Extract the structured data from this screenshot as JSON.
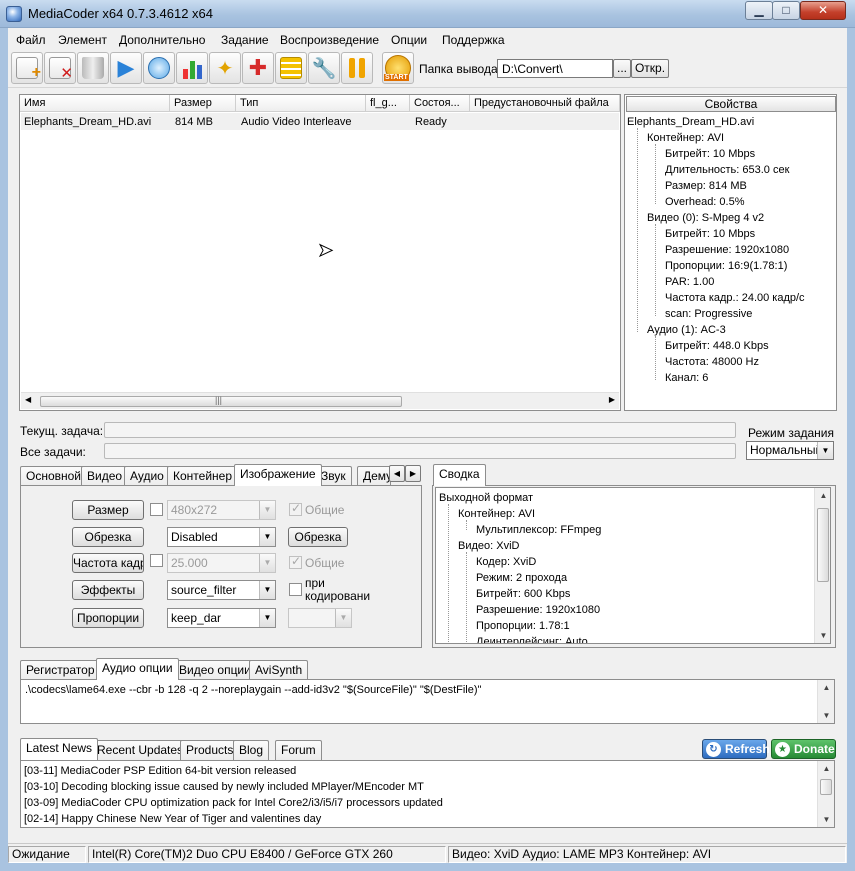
{
  "window": {
    "title": "MediaCoder x64 0.7.3.4612 x64"
  },
  "menu": [
    "Файл",
    "Элемент",
    "Дополнительно",
    "Задание",
    "Воспроизведение",
    "Опции",
    "Поддержка"
  ],
  "toolbar": {
    "buttons": [
      "add-file",
      "remove-file",
      "clear-list",
      "play",
      "preview",
      "stats",
      "wizard",
      "puzzle",
      "queue",
      "settings",
      "pause",
      "start"
    ],
    "start_label": "START",
    "output_label": "Папка вывода",
    "output_value": "D:\\Convert\\",
    "browse_label": "...",
    "open_label": "Откр."
  },
  "filelist": {
    "columns": [
      "Имя",
      "Размер",
      "Тип",
      "fl_g...",
      "Состоя...",
      "Предустановочный файла"
    ],
    "rows": [
      {
        "name": "Elephants_Dream_HD.avi",
        "size": "814 MB",
        "type": "Audio Video Interleave",
        "flg": "",
        "state": "Ready",
        "preset": ""
      }
    ]
  },
  "properties": {
    "header": "Свойства",
    "tree": [
      "Elephants_Dream_HD.avi",
      "Контейнер: AVI",
      "Битрейт: 10 Mbps",
      "Длительность: 653.0 сек",
      "Размер: 814 MB",
      "Overhead: 0.5%",
      "Видео (0): S-Mpeg 4 v2",
      "Битрейт: 10 Mbps",
      "Разрешение: 1920x1080",
      "Пропорции: 16:9(1.78:1)",
      "PAR: 1.00",
      "Частота кадр.: 24.00 кадр/с",
      "scan: Progressive",
      "Аудио (1): AC-3",
      "Битрейт: 448.0 Kbps",
      "Частота: 48000 Hz",
      "Канал: 6"
    ]
  },
  "progress": {
    "current_label": "Текущ. задача:",
    "all_label": "Все задачи:",
    "mode_label": "Режим задания",
    "mode_value": "Нормальный"
  },
  "settings_tabs": [
    "Основной",
    "Видео",
    "Аудио",
    "Контейнер",
    "Изображение",
    "Звук",
    "Дему"
  ],
  "image_panel": {
    "size_btn": "Размер",
    "size_value": "480x272",
    "general1": "Общие",
    "crop_btn": "Обрезка",
    "crop_value": "Disabled",
    "crop_btn2": "Обрезка",
    "fps_btn": "Частота кадр",
    "fps_value": "25.000",
    "general2": "Общие",
    "effects_btn": "Эффекты",
    "effects_value": "source_filter",
    "encode_label": "при кодировани",
    "aspect_btn": "Пропорции",
    "aspect_value": "keep_dar"
  },
  "summary": {
    "tab": "Сводка",
    "tree": [
      "Выходной формат",
      "Контейнер: AVI",
      "Мультиплексор: FFmpeg",
      "Видео: XviD",
      "Кодер: XviD",
      "Режим: 2 прохода",
      "Битрейт: 600 Kbps",
      "Разрешение: 1920x1080",
      "Пропорции: 1.78:1",
      "Деинтерлейсинг: Auto"
    ]
  },
  "cmd_tabs": [
    "Регистратор",
    "Аудио опции",
    "Видео опции",
    "AviSynth"
  ],
  "cmdline": ".\\codecs\\lame64.exe --cbr -b 128 -q 2 --noreplaygain --add-id3v2 \"$(SourceFile)\" \"$(DestFile)\"",
  "news_tabs": [
    "Latest News",
    "Recent Updates",
    "Products",
    "Blog",
    "Forum"
  ],
  "refresh_label": "Refresh",
  "donate_label": "Donate",
  "news": [
    "[03-11] MediaCoder PSP Edition 64-bit version released",
    "[03-10] Decoding blocking issue caused by newly included MPlayer/MEncoder MT",
    "[03-09] MediaCoder CPU optimization pack for Intel Core2/i3/i5/i7 processors updated",
    "[02-14] Happy Chinese New Year of Tiger and valentines day"
  ],
  "status": {
    "state": "Ожидание",
    "cpu": "Intel(R) Core(TM)2 Duo CPU E8400  / GeForce GTX 260",
    "format": "Видео: XviD  Аудио: LAME MP3  Контейнер: AVI"
  },
  "colors": {
    "accent": "#3a7bd5",
    "donate": "#2e9a3a",
    "title_bar": "#a9c3e0"
  }
}
